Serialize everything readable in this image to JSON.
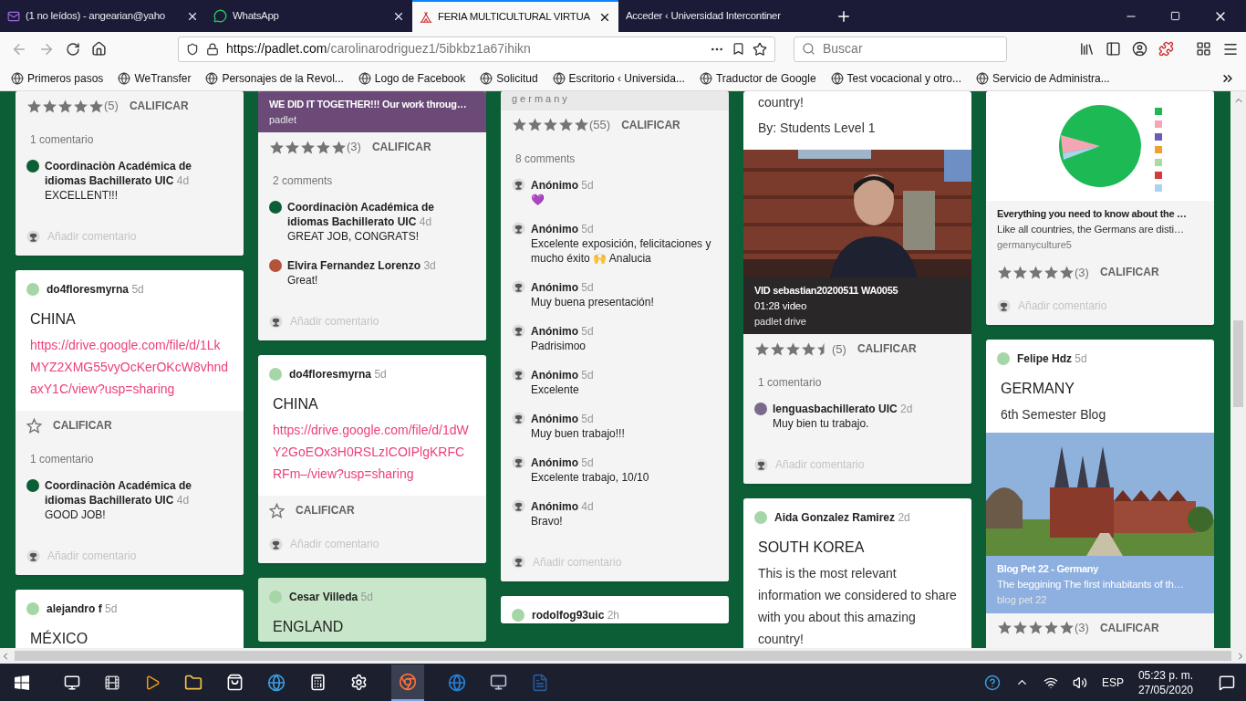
{
  "browser": {
    "tabs": [
      {
        "title": "(1 no leídos) - angearian@yaho",
        "selected": false
      },
      {
        "title": "WhatsApp",
        "selected": false
      },
      {
        "title": "FERIA MULTICULTURAL VIRTUA",
        "selected": true
      },
      {
        "title": "Acceder ‹ Universidad Intercontiner",
        "selected": false
      }
    ],
    "url_host": "https://padlet.com",
    "url_path": "/carolinarodriguez1/5ibkbz1a67ihikn",
    "search_placeholder": "Buscar",
    "bookmarks": [
      "Primeros pasos",
      "WeTransfer",
      "Personajes de la Revol...",
      "Logo de Facebook",
      "Solicitud",
      "Escritorio ‹ Universida...",
      "Traductor de Google",
      "Test vocacional y otro...",
      "Servicio de Administra..."
    ]
  },
  "columns": [
    {
      "cards": [
        {
          "rating": {
            "stars": 5,
            "count": "(5)",
            "action": "CALIFICAR"
          },
          "comments_label": "1 comentario",
          "comments": [
            {
              "author": "Coordinaciòn Académica de idiomas Bachillerato UIC",
              "time": "4d",
              "text": "EXCELLENT!!!",
              "color": "#0b5e35"
            }
          ],
          "add_comment": "Añadir comentario"
        },
        {
          "author": "do4floresmyrna",
          "time": "5d",
          "title": "CHINA",
          "link": "https://drive.google.com/file/d/1LkMYZ2XMG55vyOcKerOKcW8vhndaxY1C/view?usp=sharing",
          "rating": {
            "action": "CALIFICAR"
          },
          "comments_label": "1 comentario",
          "comments": [
            {
              "author": "Coordinaciòn Académica de idiomas Bachillerato UIC",
              "time": "4d",
              "text": "GOOD JOB!",
              "color": "#0b5e35"
            }
          ],
          "add_comment": "Añadir comentario"
        },
        {
          "author": "alejandro f",
          "time": "5d",
          "title": "MÉXICO"
        }
      ]
    },
    {
      "cards": [
        {
          "attachment": {
            "kind": "link",
            "title": "WE DID IT TOGETHER!!! Our work throug…",
            "source": "padlet",
            "color": "#6b4a78"
          },
          "rating": {
            "stars": 5,
            "count": "(3)",
            "action": "CALIFICAR"
          },
          "comments_label": "2 comments",
          "comments": [
            {
              "author": "Coordinaciòn Académica de idiomas Bachillerato UIC",
              "time": "4d",
              "text": "GREAT JOB, CONGRATS!",
              "color": "#0b5e35"
            },
            {
              "author": "Elvira Fernandez Lorenzo",
              "time": "3d",
              "text": "Great!",
              "color": "#b5523b"
            }
          ],
          "add_comment": "Añadir comentario"
        },
        {
          "author": "do4floresmyrna",
          "time": "5d",
          "title": "CHINA",
          "link": "https://drive.google.com/file/d/1dWY2GoEOx3H0RSLzICOIPlgKRFCRFm–/view?usp=sharing",
          "rating": {
            "action": "CALIFICAR"
          },
          "add_comment": "Añadir comentario"
        },
        {
          "author": "Cesar Villeda",
          "time": "5d",
          "title": "ENGLAND",
          "color": "#c8e6c9"
        }
      ]
    },
    {
      "cards": [
        {
          "caption": "germany",
          "rating": {
            "stars": 5,
            "count": "(55)",
            "action": "CALIFICAR"
          },
          "comments_label": "8 comments",
          "comments": [
            {
              "author": "Anónimo",
              "time": "5d",
              "text": "💜"
            },
            {
              "author": "Anónimo",
              "time": "5d",
              "text": "Excelente exposición, felicitaciones y mucho éxito 🙌 Analucia"
            },
            {
              "author": "Anónimo",
              "time": "5d",
              "text": "Muy buena presentación!"
            },
            {
              "author": "Anónimo",
              "time": "5d",
              "text": "Padrisimoo"
            },
            {
              "author": "Anónimo",
              "time": "5d",
              "text": "Excelente"
            },
            {
              "author": "Anónimo",
              "time": "5d",
              "text": "Muy buen trabajo!!!"
            },
            {
              "author": "Anónimo",
              "time": "5d",
              "text": "Excelente trabajo, 10/10"
            },
            {
              "author": "Anónimo",
              "time": "4d",
              "text": "Bravo!"
            }
          ],
          "add_comment": "Añadir comentario"
        },
        {
          "author": "rodolfog93uic",
          "time": "2h"
        }
      ]
    },
    {
      "cards": [
        {
          "body": "country!",
          "body2": "By: Students Level 1",
          "attachment": {
            "kind": "video",
            "title": "VID sebastian20200511 WA0055",
            "subtitle": "01:28 video",
            "source": "padlet drive",
            "color": "#2a2729"
          },
          "rating": {
            "stars": 4.5,
            "count": "(5)",
            "action": "CALIFICAR"
          },
          "comments_label": "1 comentario",
          "comments": [
            {
              "author": "lenguasbachillerato UIC",
              "time": "2d",
              "text": "Muy bien tu trabajo.",
              "color": "#7a6a8c"
            }
          ],
          "add_comment": "Añadir comentario"
        },
        {
          "author": "Aida Gonzalez Ramirez",
          "time": "2d",
          "title": "SOUTH KOREA",
          "body": "This is the most relevant information we considered to share with you about this amazing country!"
        }
      ]
    },
    {
      "cards": [
        {
          "attachment": {
            "kind": "chart",
            "title": "Everything you need to know about the …",
            "subtitle": "Like all countries, the Germans are disti…",
            "source": "germanyculture5",
            "color": "#f4f4f4"
          },
          "rating": {
            "stars": 5,
            "count": "(3)",
            "action": "CALIFICAR"
          },
          "add_comment": "Añadir comentario"
        },
        {
          "author": "Felipe Hdz",
          "time": "5d",
          "title": "GERMANY",
          "body": "6th Semester Blog",
          "attachment": {
            "title": "Blog Pet 22 - Germany",
            "subtitle": "The beggining The first inhabitants of th…",
            "source": "blog pet 22",
            "color": "#8db0e0"
          },
          "rating": {
            "stars": 5,
            "count": "(3)",
            "action": "CALIFICAR"
          }
        }
      ]
    }
  ],
  "taskbar": {
    "language": "ESP",
    "time": "05:23 p. m.",
    "date": "27/05/2020"
  }
}
